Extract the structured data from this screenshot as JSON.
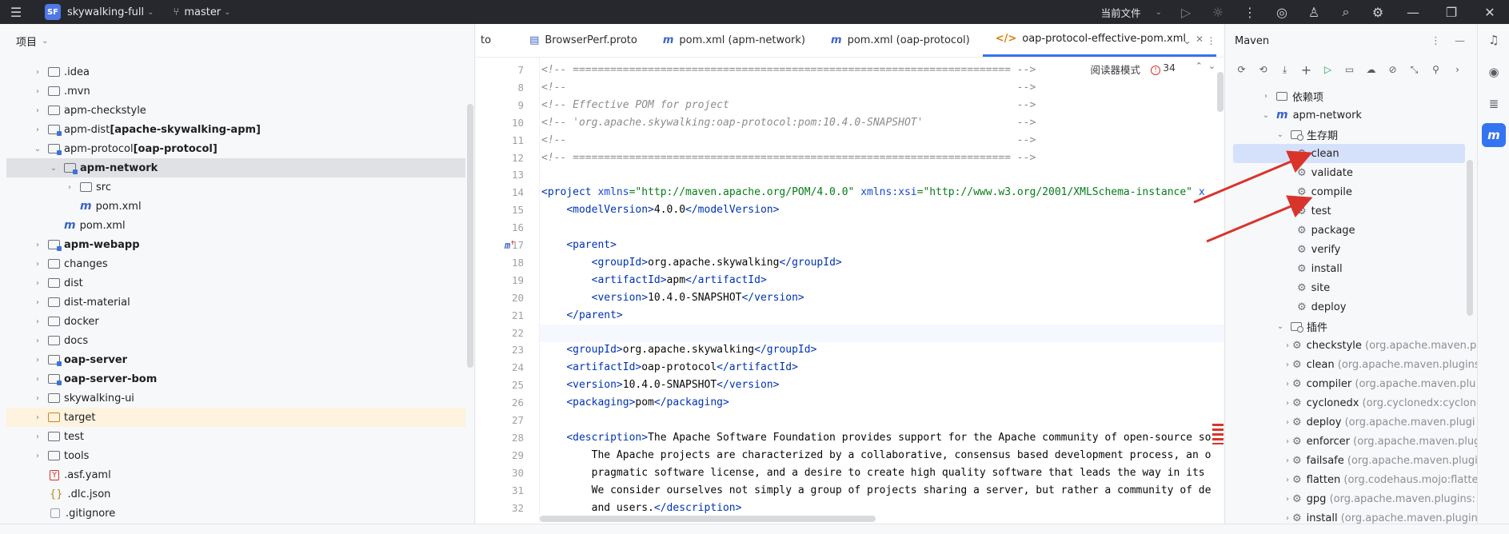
{
  "titlebar": {
    "menu_icon": "hamburger-menu-icon",
    "project_badge": "SF",
    "project_name": "skywalking-full",
    "branch": "master",
    "current_file": "当前文件"
  },
  "project_panel": {
    "title": "项目",
    "items": [
      {
        "label": "",
        "label_bold": "",
        "label_plain": ".idea",
        "type": "folder"
      },
      {
        "label_plain": ".mvn",
        "type": "folder"
      },
      {
        "label_plain": "apm-checkstyle",
        "type": "folder"
      },
      {
        "label_plain": "apm-dist ",
        "label_bold": "[apache-skywalking-apm]",
        "type": "folder"
      },
      {
        "label_plain": "apm-protocol ",
        "label_bold": "[oap-protocol]",
        "type": "folder"
      },
      {
        "label_bold": "apm-network",
        "type": "folder"
      },
      {
        "label_plain": "src",
        "type": "folder"
      },
      {
        "label_plain": "pom.xml",
        "type": "maven"
      },
      {
        "label_plain": "pom.xml",
        "type": "maven"
      },
      {
        "label_bold": "apm-webapp",
        "type": "folder"
      },
      {
        "label_plain": "changes",
        "type": "folder"
      },
      {
        "label_plain": "dist",
        "type": "folder"
      },
      {
        "label_plain": "dist-material",
        "type": "folder"
      },
      {
        "label_plain": "docker",
        "type": "folder"
      },
      {
        "label_plain": "docs",
        "type": "folder"
      },
      {
        "label_bold": "oap-server",
        "type": "folder"
      },
      {
        "label_bold": "oap-server-bom",
        "type": "folder"
      },
      {
        "label_plain": "skywalking-ui",
        "type": "folder"
      },
      {
        "label_plain": "target",
        "type": "folder"
      },
      {
        "label_plain": "test",
        "type": "folder"
      },
      {
        "label_plain": "tools",
        "type": "folder"
      },
      {
        "label_plain": ".asf.yaml",
        "type": "yaml"
      },
      {
        "label_plain": ".dlc.json",
        "type": "json"
      },
      {
        "label_plain": ".gitignore",
        "type": "text"
      }
    ]
  },
  "editor": {
    "tabs": [
      {
        "label": "to",
        "icon": ""
      },
      {
        "label": "BrowserPerf.proto",
        "icon": "proto-file-icon"
      },
      {
        "label": "pom.xml (apm-network)",
        "icon": "m"
      },
      {
        "label": "pom.xml (oap-protocol)",
        "icon": "m"
      },
      {
        "label": "oap-protocol-effective-pom.xml",
        "icon": "</>"
      }
    ],
    "reader_mode": "阅读器模式",
    "problem_count": "34",
    "lines": [
      {
        "n": "7",
        "html": "<span class='cm'>&lt;!-- ====================================================================== --&gt;</span>"
      },
      {
        "n": "8",
        "html": "<span class='cm'>&lt;!--                                                                        --&gt;</span>"
      },
      {
        "n": "9",
        "html": "<span class='cm'>&lt;!-- Effective POM for project                                              --&gt;</span>"
      },
      {
        "n": "10",
        "html": "<span class='cm'>&lt;!-- 'org.apache.skywalking:oap-protocol:pom:10.4.0-SNAPSHOT'               --&gt;</span>"
      },
      {
        "n": "11",
        "html": "<span class='cm'>&lt;!--                                                                        --&gt;</span>"
      },
      {
        "n": "12",
        "html": "<span class='cm'>&lt;!-- ====================================================================== --&gt;</span>"
      },
      {
        "n": "13",
        "html": ""
      },
      {
        "n": "14",
        "html": "<span class='tg'>&lt;project </span><span class='at'>xmlns</span><span class='av'>=\"http://maven.apache.org/POM/4.0.0\"</span> <span class='at'>xmlns:xsi</span><span class='av'>=\"http://www.w3.org/2001/XMLSchema-instance\"</span> <span class='at'>x</span>"
      },
      {
        "n": "15",
        "html": "    <span class='tg'>&lt;modelVersion&gt;</span><span class='tx'>4.0.0</span><span class='tg'>&lt;/modelVersion&gt;</span>"
      },
      {
        "n": "16",
        "html": ""
      },
      {
        "n": "17",
        "html": "    <span class='tg'>&lt;parent&gt;</span>"
      },
      {
        "n": "18",
        "html": "        <span class='tg'>&lt;groupId&gt;</span><span class='tx'>org.apache.skywalking</span><span class='tg'>&lt;/groupId&gt;</span>"
      },
      {
        "n": "19",
        "html": "        <span class='tg'>&lt;artifactId&gt;</span><span class='tx'>apm</span><span class='tg'>&lt;/artifactId&gt;</span>"
      },
      {
        "n": "20",
        "html": "        <span class='tg'>&lt;version&gt;</span><span class='tx'>10.4.0-SNAPSHOT</span><span class='tg'>&lt;/version&gt;</span>"
      },
      {
        "n": "21",
        "html": "    <span class='tg'>&lt;/parent&gt;</span>"
      },
      {
        "n": "22",
        "html": ""
      },
      {
        "n": "23",
        "html": "    <span class='tg'>&lt;groupId&gt;</span><span class='tx'>org.apache.skywalking</span><span class='tg'>&lt;/groupId&gt;</span>"
      },
      {
        "n": "24",
        "html": "    <span class='tg'>&lt;artifactId&gt;</span><span class='tx'>oap-protocol</span><span class='tg'>&lt;/artifactId&gt;</span>"
      },
      {
        "n": "25",
        "html": "    <span class='tg'>&lt;version&gt;</span><span class='tx'>10.4.0-SNAPSHOT</span><span class='tg'>&lt;/version&gt;</span>"
      },
      {
        "n": "26",
        "html": "    <span class='tg'>&lt;packaging&gt;</span><span class='tx'>pom</span><span class='tg'>&lt;/packaging&gt;</span>"
      },
      {
        "n": "27",
        "html": ""
      },
      {
        "n": "28",
        "html": "    <span class='tg'>&lt;description&gt;</span><span class='tx'>The Apache Software Foundation provides support for the Apache community of open-source so</span>"
      },
      {
        "n": "29",
        "html": "<span class='tx'>        The Apache projects are characterized by a collaborative, consensus based development process, an o</span>"
      },
      {
        "n": "30",
        "html": "<span class='tx'>        pragmatic software license, and a desire to create high quality software that leads the way in its</span>"
      },
      {
        "n": "31",
        "html": "<span class='tx'>        We consider ourselves not simply a group of projects sharing a server, but rather a community of de</span>"
      },
      {
        "n": "32",
        "html": "<span class='tx'>        and users.</span><span class='tg'>&lt;/description&gt;</span>"
      }
    ]
  },
  "maven": {
    "title": "Maven",
    "items": [
      {
        "label": "依赖项",
        "kind": "folder"
      },
      {
        "label": "apm-network",
        "kind": "module"
      },
      {
        "label": "生存期",
        "kind": "lifecycle"
      },
      {
        "label": "clean",
        "kind": "goal"
      },
      {
        "label": "validate",
        "kind": "goal"
      },
      {
        "label": "compile",
        "kind": "goal"
      },
      {
        "label": "test",
        "kind": "goal"
      },
      {
        "label": "package",
        "kind": "goal"
      },
      {
        "label": "verify",
        "kind": "goal"
      },
      {
        "label": "install",
        "kind": "goal"
      },
      {
        "label": "site",
        "kind": "goal"
      },
      {
        "label": "deploy",
        "kind": "goal"
      },
      {
        "label": "插件",
        "kind": "plugins"
      },
      {
        "label": "checkstyle",
        "sub": "(org.apache.maven.pl",
        "kind": "plugin"
      },
      {
        "label": "clean",
        "sub": "(org.apache.maven.plugins",
        "kind": "plugin"
      },
      {
        "label": "compiler",
        "sub": "(org.apache.maven.plu",
        "kind": "plugin"
      },
      {
        "label": "cyclonedx",
        "sub": "(org.cyclonedx:cyclone",
        "kind": "plugin"
      },
      {
        "label": "deploy",
        "sub": "(org.apache.maven.plugi",
        "kind": "plugin"
      },
      {
        "label": "enforcer",
        "sub": "(org.apache.maven.plugi",
        "kind": "plugin"
      },
      {
        "label": "failsafe",
        "sub": "(org.apache.maven.plugi",
        "kind": "plugin"
      },
      {
        "label": "flatten",
        "sub": "(org.codehaus.mojo:flatte",
        "kind": "plugin"
      },
      {
        "label": "gpg",
        "sub": "(org.apache.maven.plugins:",
        "kind": "plugin"
      },
      {
        "label": "install",
        "sub": "(org.apache.maven.plugin",
        "kind": "plugin"
      }
    ]
  },
  "colors": {
    "accent": "#3574f0",
    "annotation": "#d9342b"
  }
}
